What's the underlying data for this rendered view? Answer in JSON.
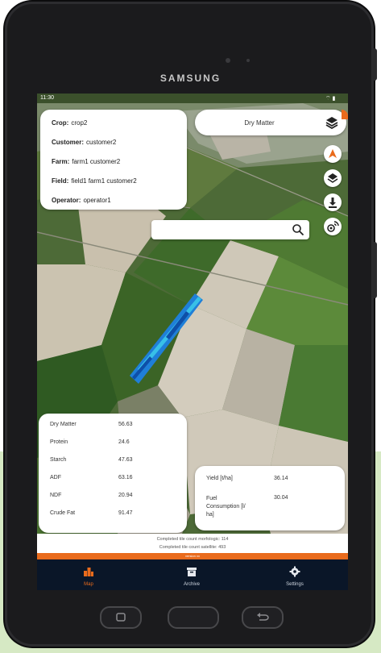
{
  "device": {
    "brand": "SAMSUNG"
  },
  "status_bar": {
    "time": "11:30",
    "right": "⌔ ▮"
  },
  "field_info": {
    "rows": [
      {
        "key": "Crop:",
        "value": "crop2"
      },
      {
        "key": "Customer:",
        "value": "customer2"
      },
      {
        "key": "Farm:",
        "value": "farm1 customer2"
      },
      {
        "key": "Field:",
        "value": "field1 farm1 customer2"
      },
      {
        "key": "Operator:",
        "value": "operator1"
      }
    ]
  },
  "layer_selector": {
    "label": "Dry Matter"
  },
  "search": {
    "placeholder": "",
    "value": ""
  },
  "quality": {
    "rows": [
      {
        "name": "Dry Matter",
        "value": "56.63"
      },
      {
        "name": "Protein",
        "value": "24.6"
      },
      {
        "name": "Starch",
        "value": "47.63"
      },
      {
        "name": "ADF",
        "value": "63.16"
      },
      {
        "name": "NDF",
        "value": "20.94"
      },
      {
        "name": "Crude Fat",
        "value": "91.47"
      }
    ]
  },
  "yield_card": {
    "yield_label": "Yield [t/ha]",
    "yield_value": "36.14",
    "fuel_label_line1": "Fuel",
    "fuel_label_line2": "Consumption [l/",
    "fuel_label_line3": "ha]",
    "fuel_value": "30.04"
  },
  "footer": {
    "line1": "Completed tile count morfologic: 114",
    "line2": "Completed tile count satellite: 493",
    "version": "version xx"
  },
  "nav": [
    {
      "label": "Map",
      "icon": "map-icon"
    },
    {
      "label": "Archive",
      "icon": "archive-icon"
    },
    {
      "label": "Settings",
      "icon": "settings-icon"
    }
  ],
  "colors": {
    "accent": "#e96b1c",
    "navbar": "#0a1628",
    "nav_active": "#e96b1c",
    "field_track": "#1f7fd8"
  }
}
